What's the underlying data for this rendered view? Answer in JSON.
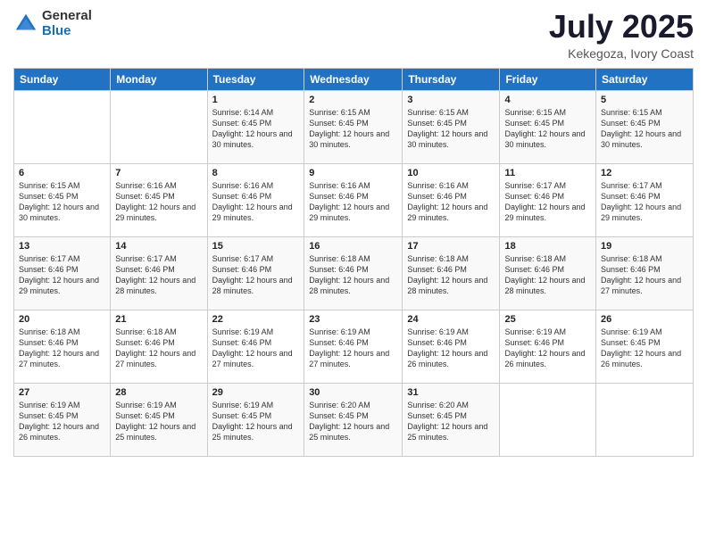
{
  "logo": {
    "general": "General",
    "blue": "Blue"
  },
  "header": {
    "title": "July 2025",
    "subtitle": "Kekegoza, Ivory Coast"
  },
  "weekdays": [
    "Sunday",
    "Monday",
    "Tuesday",
    "Wednesday",
    "Thursday",
    "Friday",
    "Saturday"
  ],
  "weeks": [
    [
      {
        "day": "",
        "info": ""
      },
      {
        "day": "",
        "info": ""
      },
      {
        "day": "1",
        "info": "Sunrise: 6:14 AM\nSunset: 6:45 PM\nDaylight: 12 hours and 30 minutes."
      },
      {
        "day": "2",
        "info": "Sunrise: 6:15 AM\nSunset: 6:45 PM\nDaylight: 12 hours and 30 minutes."
      },
      {
        "day": "3",
        "info": "Sunrise: 6:15 AM\nSunset: 6:45 PM\nDaylight: 12 hours and 30 minutes."
      },
      {
        "day": "4",
        "info": "Sunrise: 6:15 AM\nSunset: 6:45 PM\nDaylight: 12 hours and 30 minutes."
      },
      {
        "day": "5",
        "info": "Sunrise: 6:15 AM\nSunset: 6:45 PM\nDaylight: 12 hours and 30 minutes."
      }
    ],
    [
      {
        "day": "6",
        "info": "Sunrise: 6:15 AM\nSunset: 6:45 PM\nDaylight: 12 hours and 30 minutes."
      },
      {
        "day": "7",
        "info": "Sunrise: 6:16 AM\nSunset: 6:45 PM\nDaylight: 12 hours and 29 minutes."
      },
      {
        "day": "8",
        "info": "Sunrise: 6:16 AM\nSunset: 6:46 PM\nDaylight: 12 hours and 29 minutes."
      },
      {
        "day": "9",
        "info": "Sunrise: 6:16 AM\nSunset: 6:46 PM\nDaylight: 12 hours and 29 minutes."
      },
      {
        "day": "10",
        "info": "Sunrise: 6:16 AM\nSunset: 6:46 PM\nDaylight: 12 hours and 29 minutes."
      },
      {
        "day": "11",
        "info": "Sunrise: 6:17 AM\nSunset: 6:46 PM\nDaylight: 12 hours and 29 minutes."
      },
      {
        "day": "12",
        "info": "Sunrise: 6:17 AM\nSunset: 6:46 PM\nDaylight: 12 hours and 29 minutes."
      }
    ],
    [
      {
        "day": "13",
        "info": "Sunrise: 6:17 AM\nSunset: 6:46 PM\nDaylight: 12 hours and 29 minutes."
      },
      {
        "day": "14",
        "info": "Sunrise: 6:17 AM\nSunset: 6:46 PM\nDaylight: 12 hours and 28 minutes."
      },
      {
        "day": "15",
        "info": "Sunrise: 6:17 AM\nSunset: 6:46 PM\nDaylight: 12 hours and 28 minutes."
      },
      {
        "day": "16",
        "info": "Sunrise: 6:18 AM\nSunset: 6:46 PM\nDaylight: 12 hours and 28 minutes."
      },
      {
        "day": "17",
        "info": "Sunrise: 6:18 AM\nSunset: 6:46 PM\nDaylight: 12 hours and 28 minutes."
      },
      {
        "day": "18",
        "info": "Sunrise: 6:18 AM\nSunset: 6:46 PM\nDaylight: 12 hours and 28 minutes."
      },
      {
        "day": "19",
        "info": "Sunrise: 6:18 AM\nSunset: 6:46 PM\nDaylight: 12 hours and 27 minutes."
      }
    ],
    [
      {
        "day": "20",
        "info": "Sunrise: 6:18 AM\nSunset: 6:46 PM\nDaylight: 12 hours and 27 minutes."
      },
      {
        "day": "21",
        "info": "Sunrise: 6:18 AM\nSunset: 6:46 PM\nDaylight: 12 hours and 27 minutes."
      },
      {
        "day": "22",
        "info": "Sunrise: 6:19 AM\nSunset: 6:46 PM\nDaylight: 12 hours and 27 minutes."
      },
      {
        "day": "23",
        "info": "Sunrise: 6:19 AM\nSunset: 6:46 PM\nDaylight: 12 hours and 27 minutes."
      },
      {
        "day": "24",
        "info": "Sunrise: 6:19 AM\nSunset: 6:46 PM\nDaylight: 12 hours and 26 minutes."
      },
      {
        "day": "25",
        "info": "Sunrise: 6:19 AM\nSunset: 6:46 PM\nDaylight: 12 hours and 26 minutes."
      },
      {
        "day": "26",
        "info": "Sunrise: 6:19 AM\nSunset: 6:45 PM\nDaylight: 12 hours and 26 minutes."
      }
    ],
    [
      {
        "day": "27",
        "info": "Sunrise: 6:19 AM\nSunset: 6:45 PM\nDaylight: 12 hours and 26 minutes."
      },
      {
        "day": "28",
        "info": "Sunrise: 6:19 AM\nSunset: 6:45 PM\nDaylight: 12 hours and 25 minutes."
      },
      {
        "day": "29",
        "info": "Sunrise: 6:19 AM\nSunset: 6:45 PM\nDaylight: 12 hours and 25 minutes."
      },
      {
        "day": "30",
        "info": "Sunrise: 6:20 AM\nSunset: 6:45 PM\nDaylight: 12 hours and 25 minutes."
      },
      {
        "day": "31",
        "info": "Sunrise: 6:20 AM\nSunset: 6:45 PM\nDaylight: 12 hours and 25 minutes."
      },
      {
        "day": "",
        "info": ""
      },
      {
        "day": "",
        "info": ""
      }
    ]
  ]
}
